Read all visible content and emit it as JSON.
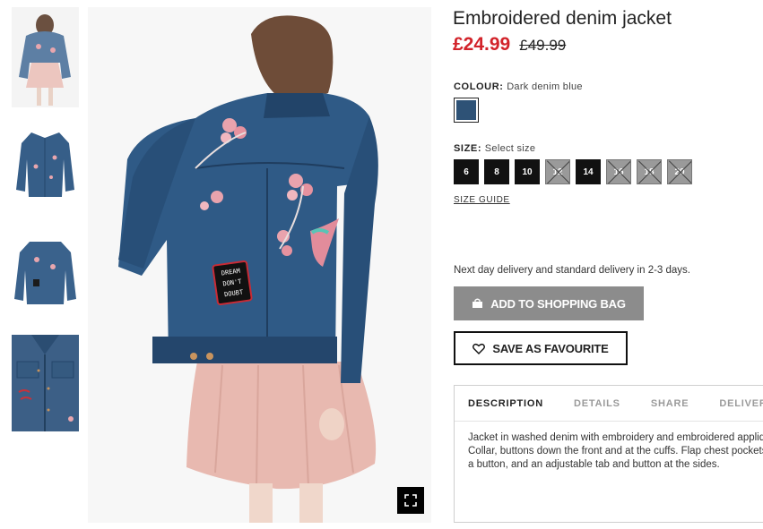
{
  "product": {
    "title": "Embroidered denim jacket",
    "price_sale": "£24.99",
    "price_original": "£49.99"
  },
  "colour": {
    "label": "COLOUR:",
    "value": "Dark denim blue",
    "swatch_color": "#2e5276"
  },
  "size": {
    "label": "SIZE:",
    "placeholder": "Select size",
    "options": [
      {
        "label": "6",
        "available": true
      },
      {
        "label": "8",
        "available": true
      },
      {
        "label": "10",
        "available": true
      },
      {
        "label": "12",
        "available": false
      },
      {
        "label": "14",
        "available": true
      },
      {
        "label": "16",
        "available": false
      },
      {
        "label": "18",
        "available": false
      },
      {
        "label": "20",
        "available": false
      }
    ],
    "guide_label": "SIZE GUIDE"
  },
  "delivery_text": "Next day delivery and standard delivery in 2-3 days.",
  "buttons": {
    "add_to_bag": "ADD TO SHOPPING BAG",
    "save_favourite": "SAVE AS FAVOURITE"
  },
  "tabs": [
    {
      "label": "DESCRIPTION",
      "active": true
    },
    {
      "label": "DETAILS",
      "active": false
    },
    {
      "label": "SHARE",
      "active": false
    },
    {
      "label": "DELIVERY",
      "active": false
    }
  ],
  "description": "Jacket in washed denim with embroidery and embroidered appliqués. Collar, buttons down the front and at the cuffs. Flap chest pockets with a button, and an adjustable tab and button at the sides.",
  "patch_text": [
    "DREAM",
    "DON'T",
    "DOUBT"
  ],
  "colors": {
    "sale_price": "#d2232a",
    "add_button_bg": "#8c8c8c",
    "denim": "#2e5276",
    "skirt": "#e8b9b0"
  },
  "icons": {
    "expand": "expand-icon",
    "bag": "shopping-bag-icon",
    "heart": "heart-icon"
  }
}
